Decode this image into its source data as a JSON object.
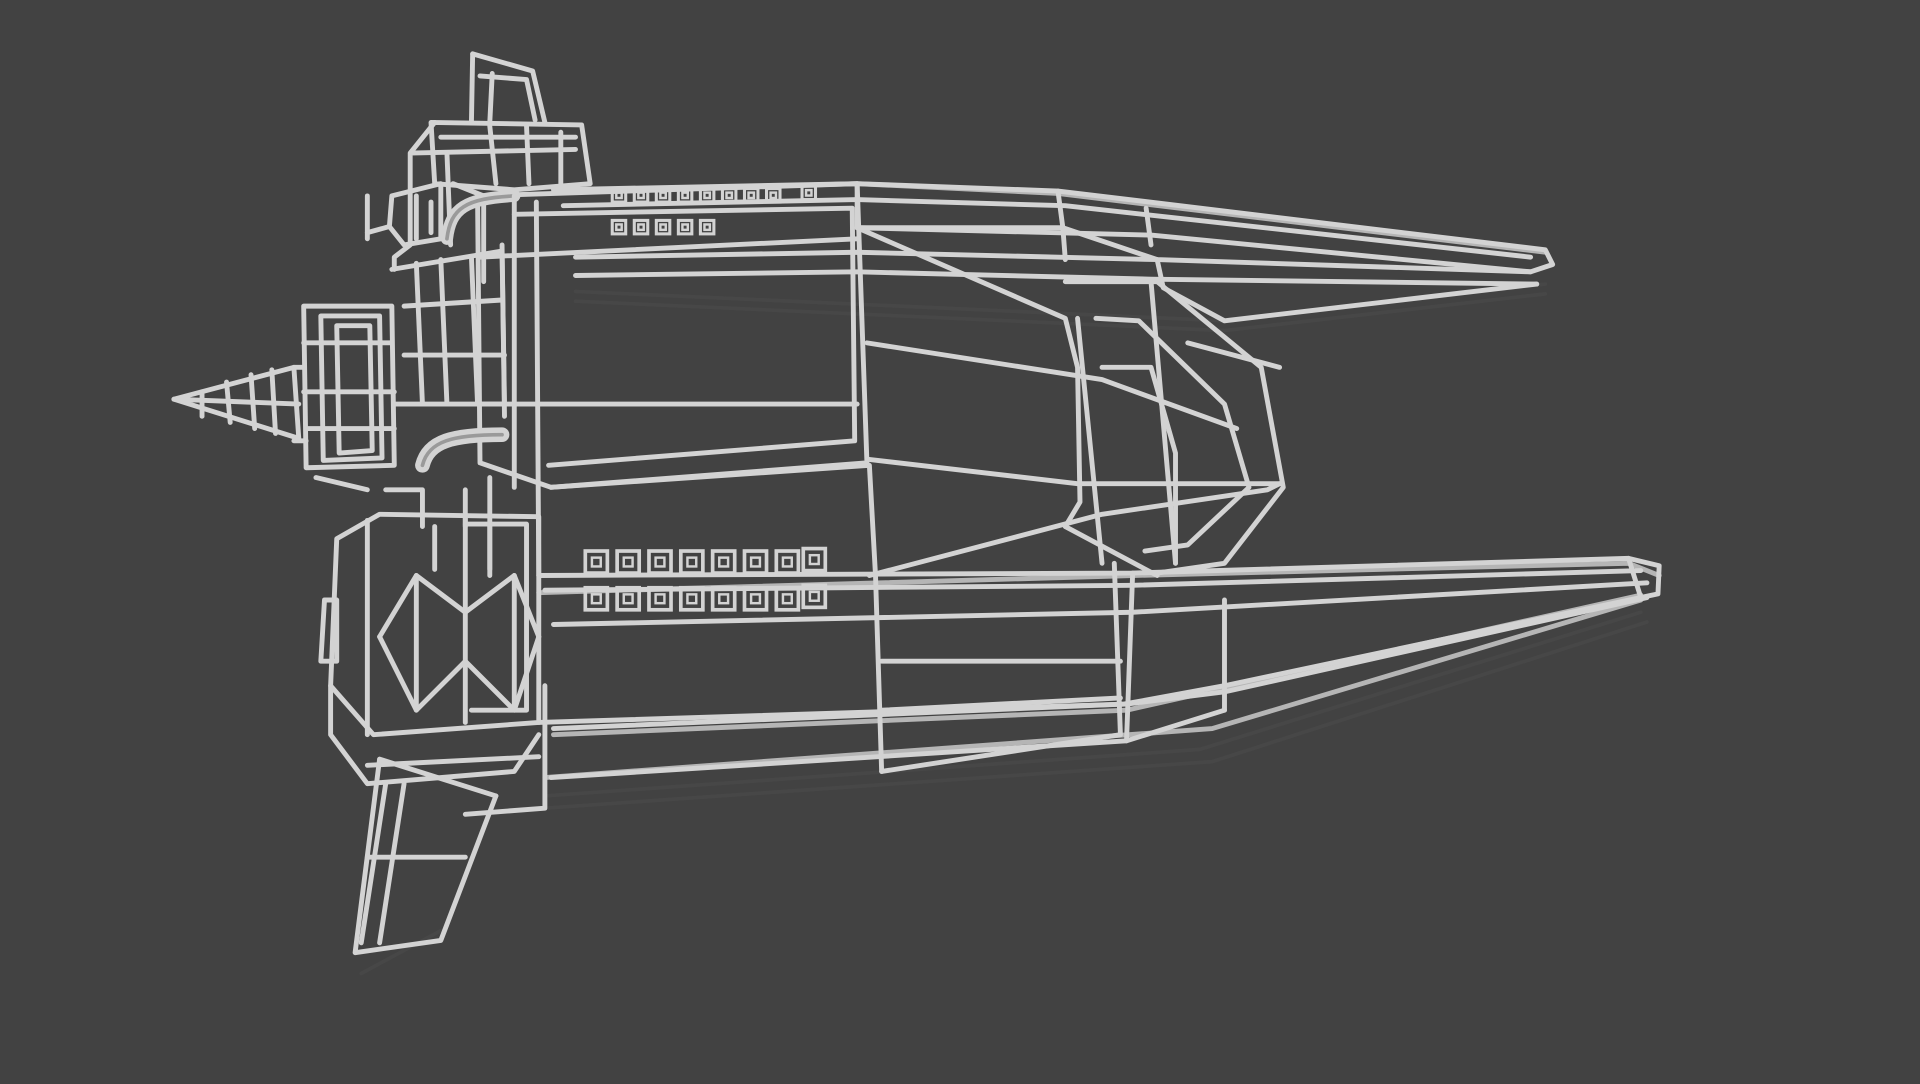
{
  "scene": {
    "background_color": "#424242",
    "wire_color": "#d3d3d3",
    "wire_shadow_color": "#b5b5b5",
    "reflection_color": "#4d4d4d",
    "subject": "wireframe-spaceship-model"
  }
}
